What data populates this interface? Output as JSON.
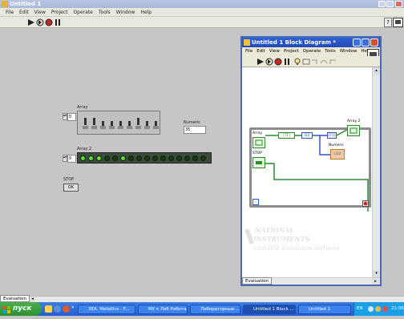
{
  "main_window": {
    "title": "Untitled 1",
    "menu": [
      "File",
      "Edit",
      "View",
      "Project",
      "Operate",
      "Tools",
      "Window",
      "Help"
    ]
  },
  "front_panel": {
    "array": {
      "label": "Array",
      "index": "0",
      "toggle_states": [
        1,
        1,
        0,
        0,
        0,
        0,
        1,
        0,
        0
      ]
    },
    "numeric": {
      "label": "Numeric",
      "value": "35"
    },
    "array2": {
      "label": "Array 2",
      "index": "0",
      "leds": [
        1,
        1,
        1,
        0,
        0,
        1,
        0,
        0,
        0,
        0,
        0,
        0,
        0,
        0,
        0,
        0
      ]
    },
    "stop": {
      "label": "STOP",
      "button_text": "OK"
    }
  },
  "block_diagram": {
    "title": "Untitled 1 Block Diagram *",
    "menu": [
      "File",
      "Edit",
      "View",
      "Project",
      "Operate",
      "Tools",
      "Window",
      "Help"
    ],
    "nodes": {
      "array_label": "Array",
      "array2_label": "Array 2",
      "numeric_label": "Numeric",
      "stop_label": "STOP",
      "bool_type": "[TF]",
      "bool_type2": "[?1]",
      "i32_type": "I32",
      "loop_index": "i",
      "numeric_type": "U32"
    },
    "watermark": [
      "NATIONAL",
      "INSTRUMENTS",
      "LabVIEW Evaluation Software"
    ],
    "status_tab": "Evaluation"
  },
  "main_status_tab": "Evaluation",
  "taskbar": {
    "start_label": "пуск",
    "tasks": [
      "3ЕА. Metallics - F...",
      "МУ к Лаб Работам",
      "Лабораторные ...",
      "Untitled 1 Block ...",
      "Untitled 1"
    ],
    "lang": "EN",
    "clock": "21:06"
  },
  "colors": {
    "title_bar": "#2e5fd6",
    "taskbar": "#245ed0",
    "start_button": "#2f8f33",
    "led_on": "#5fdc3a",
    "led_off": "#1a3a12"
  }
}
